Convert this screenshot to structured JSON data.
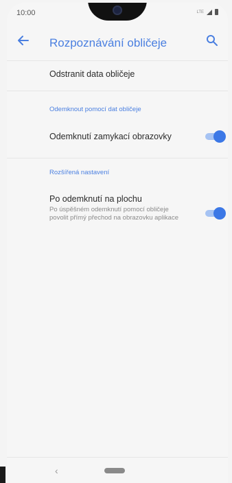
{
  "status": {
    "time": "10:00",
    "lte_label": "LTE"
  },
  "appbar": {
    "title": "Rozpoznávání obličeje"
  },
  "items": {
    "remove_data": "Odstranit data obličeje",
    "section_unlock": "Odemknout pomocí dat obličeje",
    "lockscreen_unlock": "Odemknutí zamykací obrazovky",
    "section_advanced": "Rozšířená nastavení",
    "skip_to_home": "Po odemknutí na plochu",
    "skip_to_home_desc": "Po úspěšném odemknutí pomocí obličeje povolit přímý přechod na obrazovku aplikace"
  },
  "toggles": {
    "lockscreen_unlock_on": true,
    "skip_to_home_on": true
  },
  "navbar": {
    "back_glyph": "‹"
  },
  "colors": {
    "accent": "#3c78e6",
    "title": "#4a7fe0"
  }
}
